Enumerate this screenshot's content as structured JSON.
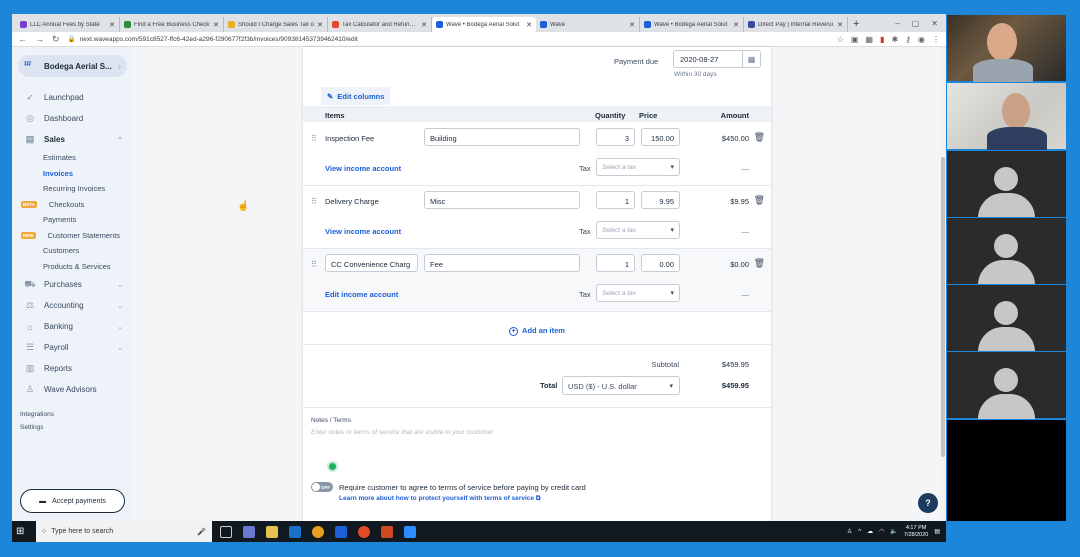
{
  "browser": {
    "tabs": [
      {
        "title": "LLC Annual Fees by State",
        "color": "#7b3fd0"
      },
      {
        "title": "Find a Free Business Check",
        "color": "#2e8b3a"
      },
      {
        "title": "Should I Charge Sales Tax o",
        "color": "#e8b020"
      },
      {
        "title": "Tax Calculator and Refund E",
        "color": "#e04a2a"
      },
      {
        "title": "Wave • Bodega Aerial Solut",
        "color": "#1d5fd8",
        "active": true
      },
      {
        "title": "Wave",
        "color": "#1d5fd8"
      },
      {
        "title": "Wave • Bodega Aerial Solut",
        "color": "#1d5fd8"
      },
      {
        "title": "Direct Pay | Internal Revenu",
        "color": "#3a4a9e"
      }
    ],
    "url": "next.waveapps.com/591c8527-ffc6-42ed-a296-f290677f2f3b/invoices/909381453739462410/edit"
  },
  "sidebar": {
    "business": "Bodega Aerial S...",
    "nav": [
      {
        "label": "Launchpad",
        "icon": "rocket-icon"
      },
      {
        "label": "Dashboard",
        "icon": "dashboard-icon"
      },
      {
        "label": "Sales",
        "icon": "sales-icon",
        "bold": true,
        "expanded": true
      }
    ],
    "sales_sub": [
      {
        "label": "Estimates"
      },
      {
        "label": "Invoices",
        "active": true
      },
      {
        "label": "Recurring Invoices"
      },
      {
        "label": "Checkouts",
        "badge": "BETA"
      },
      {
        "label": "Payments"
      },
      {
        "label": "Customer Statements",
        "badge": "NEW"
      },
      {
        "label": "Customers"
      },
      {
        "label": "Products & Services"
      }
    ],
    "nav2": [
      {
        "label": "Purchases",
        "icon": "cart-icon"
      },
      {
        "label": "Accounting",
        "icon": "scale-icon"
      },
      {
        "label": "Banking",
        "icon": "bank-icon"
      },
      {
        "label": "Payroll",
        "icon": "payroll-icon"
      },
      {
        "label": "Reports",
        "icon": "bar-chart-icon"
      },
      {
        "label": "Wave Advisors",
        "icon": "advisor-icon"
      }
    ],
    "integrations": "Integrations",
    "settings": "Settings",
    "accept_payments": "Accept payments"
  },
  "invoice": {
    "payment_due_label": "Payment due",
    "payment_due_value": "2020-08-27",
    "payment_due_note": "Within 30 days",
    "edit_columns": "Edit columns",
    "headers": {
      "items": "Items",
      "quantity": "Quantity",
      "price": "Price",
      "amount": "Amount"
    },
    "rows": [
      {
        "name": "Inspection Fee",
        "description": "Building",
        "quantity": "3",
        "price": "150.00",
        "amount": "$450.00",
        "income_link": "View income account",
        "tax_label": "Tax",
        "tax_placeholder": "Select a tax",
        "tax_amount": "—"
      },
      {
        "name": "Delivery Charge",
        "description": "Misc",
        "quantity": "1",
        "price": "9.95",
        "amount": "$9.95",
        "income_link": "View income account",
        "tax_label": "Tax",
        "tax_placeholder": "Select a tax",
        "tax_amount": "—"
      },
      {
        "name": "CC Convenience Charg",
        "description": "Fee",
        "quantity": "1",
        "price": "0.00",
        "amount": "$0.00",
        "income_link": "Edit income account",
        "tax_label": "Tax",
        "tax_placeholder": "Select a tax",
        "tax_amount": "—",
        "editable": true
      }
    ],
    "add_item": "Add an item",
    "subtotal_label": "Subtotal",
    "subtotal_value": "$459.95",
    "total_label": "Total",
    "currency": "USD ($) - U.S. dollar",
    "total_value": "$459.95",
    "notes_label": "Notes / Terms",
    "notes_placeholder": "Enter notes or terms of service that are visible to your customer",
    "toggle_label": "OFF",
    "require_terms": "Require customer to agree to terms of service before paying by credit card",
    "learn_more": "Learn more about how to protect yourself with terms of service"
  },
  "taskbar": {
    "search_placeholder": "Type here to search",
    "time": "4:17 PM",
    "date": "7/28/2020"
  }
}
